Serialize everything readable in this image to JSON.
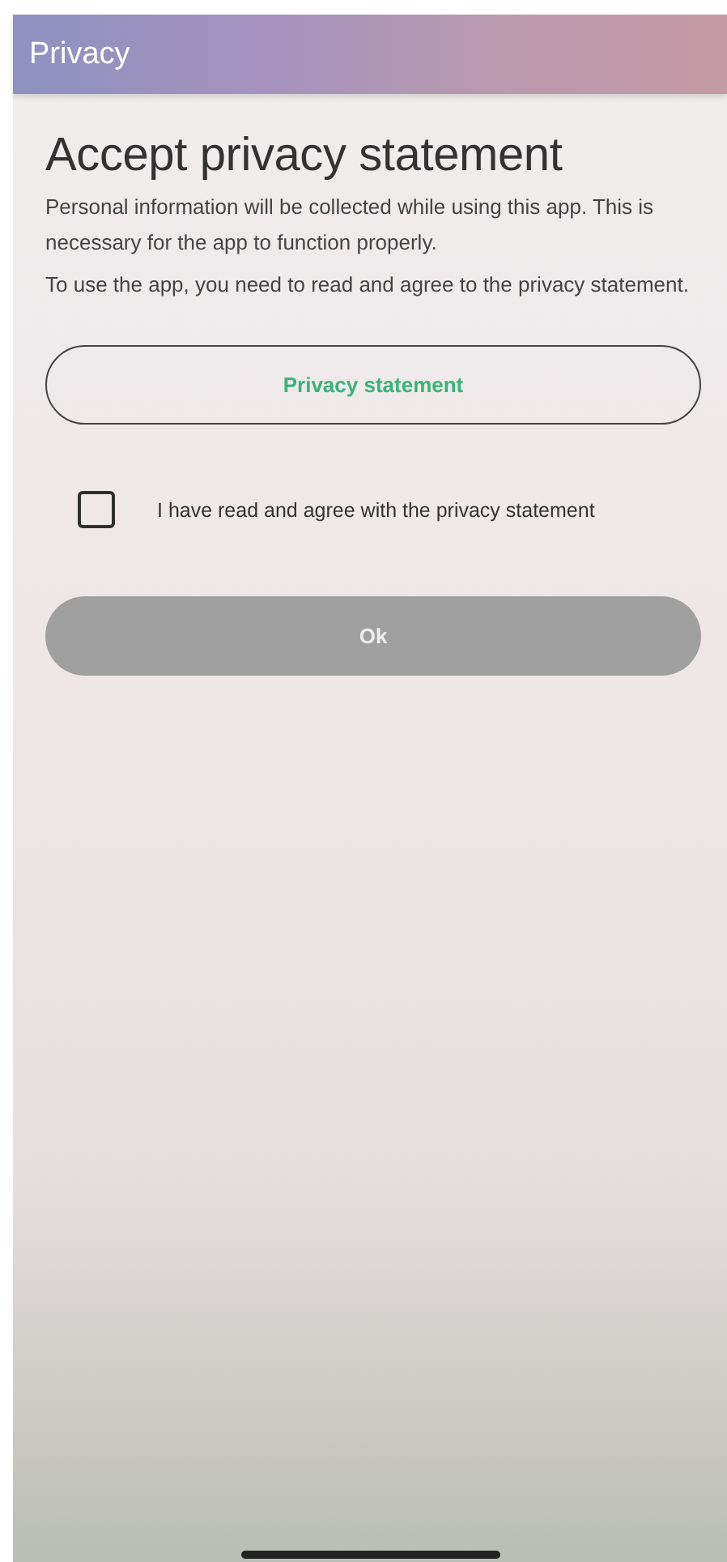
{
  "app_bar": {
    "title": "Privacy"
  },
  "heading": "Accept privacy statement",
  "paragraphs": [
    "Personal information will be collected while using this app. This is necessary for the app to function properly.",
    "To use the app, you need to read and agree to the privacy statement."
  ],
  "statement_button": {
    "label": "Privacy statement"
  },
  "consent": {
    "label": "I have read and agree with the privacy statement",
    "checked": false
  },
  "ok_button": {
    "label": "Ok",
    "disabled": true
  }
}
